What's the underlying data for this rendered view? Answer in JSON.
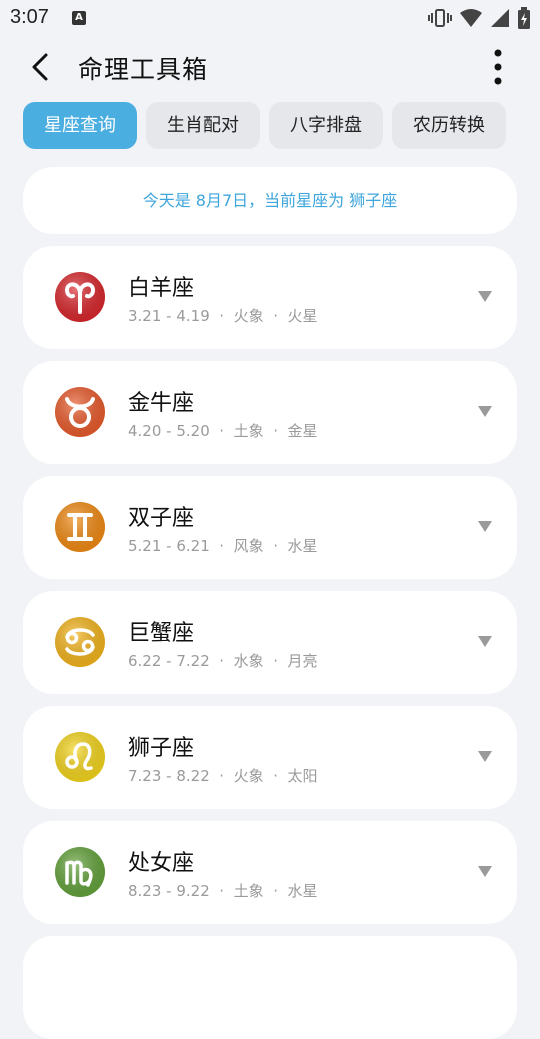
{
  "status_bar": {
    "time": "3:07",
    "a_label": "A"
  },
  "header": {
    "title": "命理工具箱"
  },
  "tabs": [
    {
      "label": "星座查询",
      "active": true
    },
    {
      "label": "生肖配对",
      "active": false
    },
    {
      "label": "八字排盘",
      "active": false
    },
    {
      "label": "农历转换",
      "active": false
    }
  ],
  "banner": {
    "text": "今天是 8月7日，当前星座为 狮子座"
  },
  "signs": [
    {
      "name": "白羊座",
      "dates": "3.21 - 4.19",
      "element": "火象",
      "planet": "火星",
      "color": "#d9262b",
      "icon": "aries-icon"
    },
    {
      "name": "金牛座",
      "dates": "4.20 - 5.20",
      "element": "土象",
      "planet": "金星",
      "color": "#ea5a2a",
      "icon": "taurus-icon"
    },
    {
      "name": "双子座",
      "dates": "5.21 - 6.21",
      "element": "风象",
      "planet": "水星",
      "color": "#f28a12",
      "icon": "gemini-icon"
    },
    {
      "name": "巨蟹座",
      "dates": "6.22 - 7.22",
      "element": "水象",
      "planet": "月亮",
      "color": "#f5b51b",
      "icon": "cancer-icon"
    },
    {
      "name": "狮子座",
      "dates": "7.23 - 8.22",
      "element": "火象",
      "planet": "太阳",
      "color": "#f5d61b",
      "icon": "leo-icon"
    },
    {
      "name": "处女座",
      "dates": "8.23 - 9.22",
      "element": "土象",
      "planet": "水星",
      "color": "#63a33a",
      "icon": "virgo-icon"
    }
  ],
  "separator": "·"
}
